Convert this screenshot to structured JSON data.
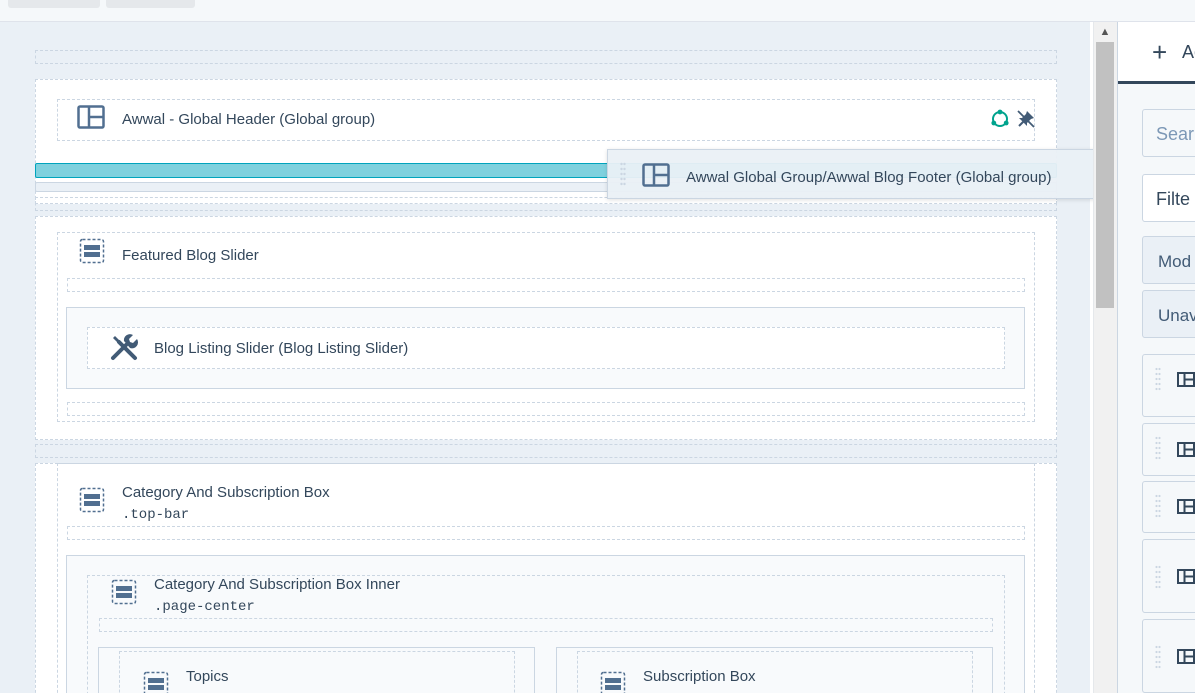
{
  "editor": {
    "global_header_label": "Awwal - Global Header (Global group)",
    "featured_slider_label": "Featured Blog Slider",
    "blog_listing_label": "Blog Listing Slider (Blog Listing Slider)",
    "category_box_label": "Category And Subscription Box",
    "category_box_class": ".top-bar",
    "category_inner_label": "Category And Subscription Box Inner",
    "category_inner_class": ".page-center",
    "topics_label": "Topics",
    "subscription_label": "Subscription Box"
  },
  "drag_ghost": {
    "label": "Awwal Global Group/Awwal Blog Footer (Global group)"
  },
  "panel": {
    "tab_label": "Ac",
    "search_placeholder": "Sear",
    "filter_label": "Filte",
    "button1_label": "Mod",
    "button2_label": "Unav"
  },
  "colors": {
    "drop_indicator": "#7fd1de",
    "global_icon": "#00a38d",
    "text": "#33475b"
  },
  "icons": {
    "layout": "layout-icon",
    "group": "group-icon",
    "module": "wrench-icon",
    "global": "global-icon",
    "unpin": "unpin-icon"
  }
}
